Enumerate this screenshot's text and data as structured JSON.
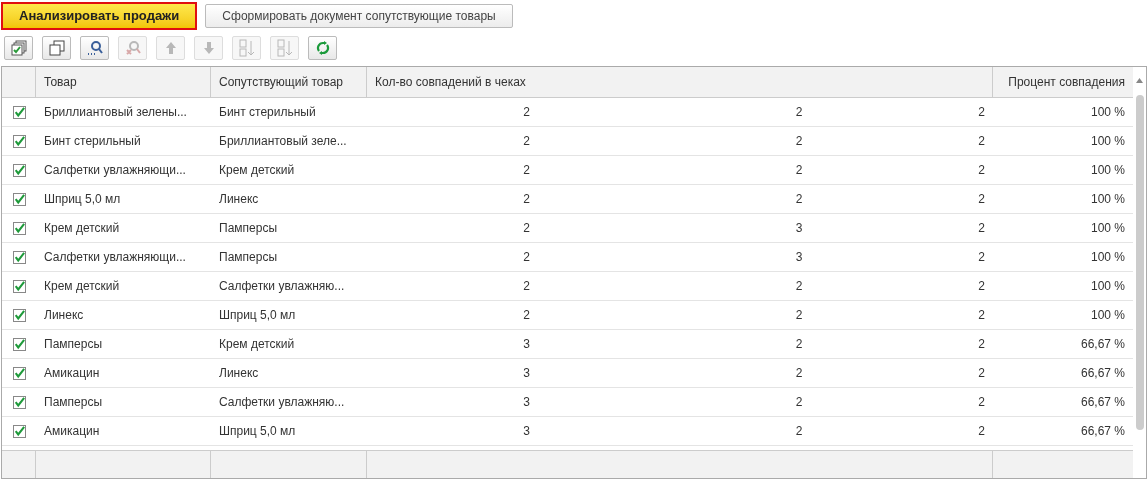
{
  "buttons": [
    {
      "label": "Анализировать продажи",
      "kind": "primary"
    },
    {
      "label": "Сформировать документ сопутствующие товары",
      "kind": "normal"
    }
  ],
  "toolbar": [
    {
      "kind": "check-all",
      "disabled": false
    },
    {
      "kind": "copy",
      "disabled": false
    },
    {
      "kind": "find",
      "disabled": false
    },
    {
      "kind": "cancel-find",
      "disabled": true
    },
    {
      "kind": "move-up",
      "disabled": true
    },
    {
      "kind": "move-down",
      "disabled": true
    },
    {
      "kind": "sort-asc",
      "disabled": true
    },
    {
      "kind": "sort-desc",
      "disabled": true
    },
    {
      "kind": "refresh",
      "disabled": false
    }
  ],
  "table": {
    "columns": [
      "Товар",
      "Сопутствующий товар",
      "Кол-во совпадений в чеках",
      "Процент совпадения"
    ],
    "rows": [
      {
        "checked": true,
        "product": "Бриллиантовый зелены...",
        "related": "Бинт стерильный",
        "column_3": "2",
        "column_4": "2",
        "column_5": "2",
        "percent": "100 %"
      },
      {
        "checked": true,
        "product": "Бинт стерильный",
        "related": "Бриллиантовый зеле...",
        "column_3": "2",
        "column_4": "2",
        "column_5": "2",
        "percent": "100 %"
      },
      {
        "checked": true,
        "product": "Салфетки увлажняющи...",
        "related": "Крем детский",
        "column_3": "2",
        "column_4": "2",
        "column_5": "2",
        "percent": "100 %"
      },
      {
        "checked": true,
        "product": "Шприц 5,0 мл",
        "related": "Линекс",
        "column_3": "2",
        "column_4": "2",
        "column_5": "2",
        "percent": "100 %"
      },
      {
        "checked": true,
        "product": "Крем детский",
        "related": "Памперсы",
        "column_3": "2",
        "column_4": "3",
        "column_5": "2",
        "percent": "100 %"
      },
      {
        "checked": true,
        "product": "Салфетки увлажняющи...",
        "related": "Памперсы",
        "column_3": "2",
        "column_4": "3",
        "column_5": "2",
        "percent": "100 %"
      },
      {
        "checked": true,
        "product": "Крем детский",
        "related": "Салфетки увлажняю...",
        "column_3": "2",
        "column_4": "2",
        "column_5": "2",
        "percent": "100 %"
      },
      {
        "checked": true,
        "product": "Линекс",
        "related": "Шприц 5,0 мл",
        "column_3": "2",
        "column_4": "2",
        "column_5": "2",
        "percent": "100 %"
      },
      {
        "checked": true,
        "product": "Памперсы",
        "related": "Крем детский",
        "column_3": "3",
        "column_4": "2",
        "column_5": "2",
        "percent": "66,67 %"
      },
      {
        "checked": true,
        "product": "Амикацин",
        "related": "Линекс",
        "column_3": "3",
        "column_4": "2",
        "column_5": "2",
        "percent": "66,67 %"
      },
      {
        "checked": true,
        "product": "Памперсы",
        "related": "Салфетки увлажняю...",
        "column_3": "3",
        "column_4": "2",
        "column_5": "2",
        "percent": "66,67 %"
      },
      {
        "checked": true,
        "product": "Амикацин",
        "related": "Шприц 5,0 мл",
        "column_3": "3",
        "column_4": "2",
        "column_5": "2",
        "percent": "66,67 %"
      }
    ]
  }
}
